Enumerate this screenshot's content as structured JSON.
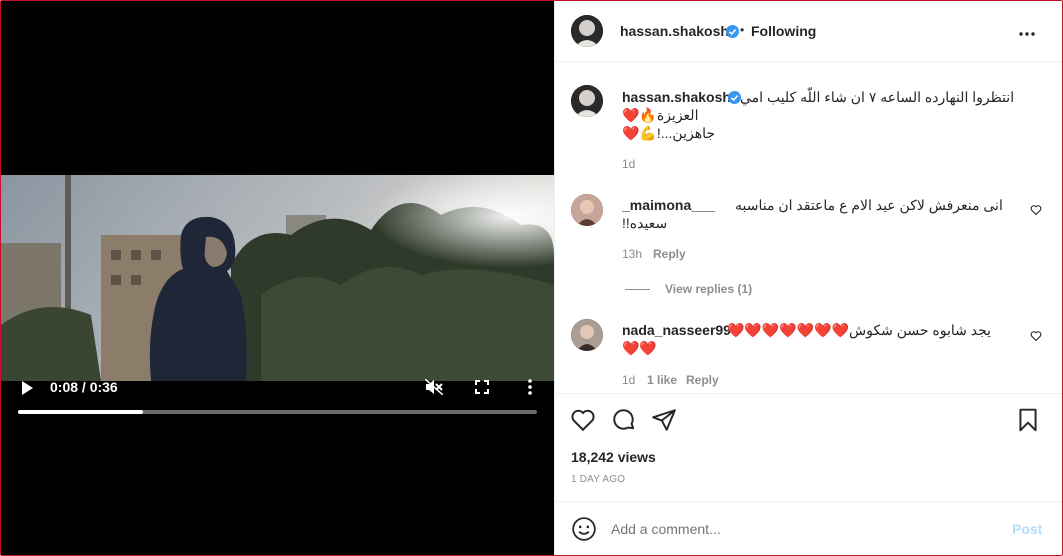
{
  "video": {
    "time_display": "0:08 / 0:36",
    "progress_fraction": 0.24
  },
  "header": {
    "username": "hassan.shakosh",
    "separator": "•",
    "follow_status": "Following",
    "more_icon": "more-horizontal-icon"
  },
  "caption": {
    "username": "hassan.shakosh",
    "line1": "انتظروا النهارده الساعه ٧ ان شاء اللّه كليب امي",
    "line2": "العزيزة🔥❤️",
    "line3": "جاهزين...!💪❤️",
    "age": "1d"
  },
  "comments": [
    {
      "username": "_maimona___",
      "text_line1": "انى منعرفش لاكن عيد الام ع ماعتقد ان مناسبه",
      "text_line2": "سعيده!!",
      "age": "13h",
      "reply_label": "Reply",
      "view_replies": "View replies (1)"
    },
    {
      "username": "nada_nasseer99",
      "text_line1": "يجد شابوه حسن شكوش❤️❤️❤️❤️❤️❤️❤️",
      "text_line2": "❤️❤️",
      "age": "1d",
      "likes": "1 like",
      "reply_label": "Reply"
    }
  ],
  "stats": {
    "views": "18,242 views",
    "posted": "1 DAY AGO"
  },
  "compose": {
    "placeholder": "Add a comment...",
    "post_label": "Post"
  },
  "colors": {
    "verified": "#3897f0",
    "post_disabled": "#b2dffc",
    "video_bg": "#000000"
  }
}
